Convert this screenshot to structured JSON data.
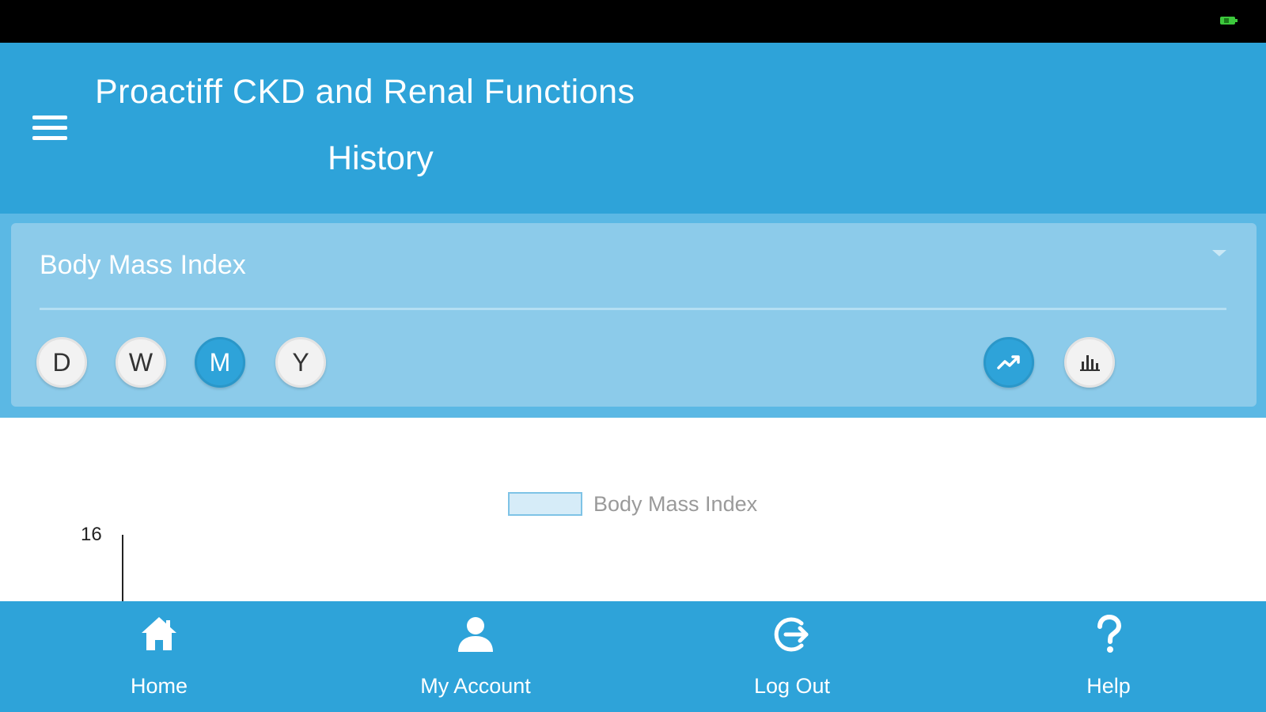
{
  "header": {
    "app_title": "Proactiff CKD and Renal Functions",
    "page_title": "History"
  },
  "metric_select": {
    "selected": "Body Mass Index"
  },
  "period_buttons": [
    {
      "label": "D",
      "active": false
    },
    {
      "label": "W",
      "active": false
    },
    {
      "label": "M",
      "active": true
    },
    {
      "label": "Y",
      "active": false
    }
  ],
  "chart_type_buttons": [
    {
      "icon": "line-chart-icon",
      "active": true
    },
    {
      "icon": "bar-chart-icon",
      "active": false
    }
  ],
  "chart_data": {
    "type": "line",
    "title": "",
    "series": [
      {
        "name": "Body Mass Index",
        "values": []
      }
    ],
    "y_ticks": [
      "16"
    ],
    "legend_position": "top-center"
  },
  "bottom_nav": [
    {
      "label": "Home",
      "icon": "home-icon"
    },
    {
      "label": "My Account",
      "icon": "user-icon"
    },
    {
      "label": "Log Out",
      "icon": "logout-icon"
    },
    {
      "label": "Help",
      "icon": "help-icon"
    }
  ],
  "colors": {
    "primary": "#2ea3d9",
    "card": "#8ccbea",
    "band": "#5bb8e4",
    "status_bar": "#000000",
    "battery": "#3cc83c"
  }
}
